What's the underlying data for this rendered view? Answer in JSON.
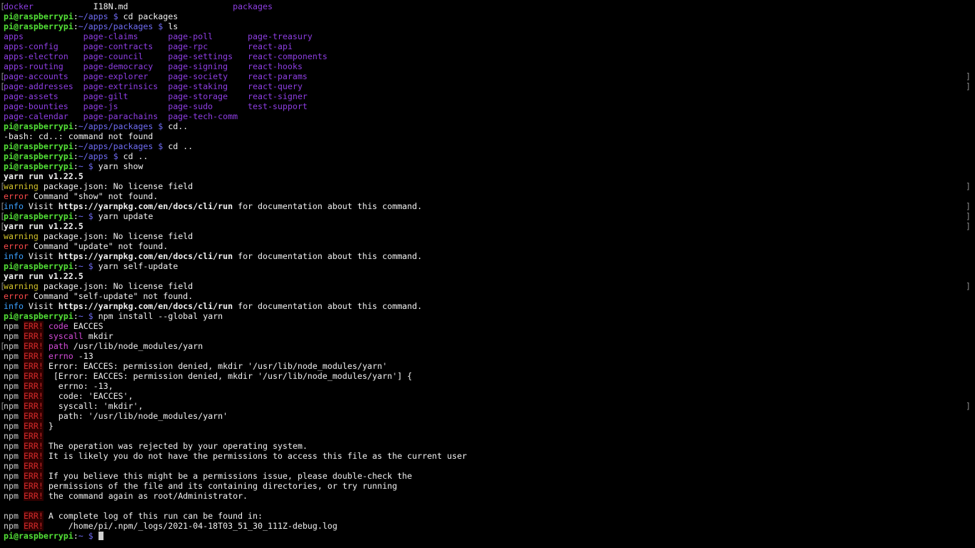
{
  "colors": {
    "background": "#000000",
    "prompt_user_host": "#53e236",
    "prompt_path": "#6f6cf5",
    "directory": "#8e3ee3",
    "warning": "#d3c22a",
    "error": "#ff4b4b",
    "info": "#3aa0ff",
    "npm_err_key": "#d34bd8",
    "npm_err_badge": "#d32a2a"
  },
  "terminal": {
    "lines": [
      {
        "lb": "[",
        "segs": [
          {
            "c": "c-purple",
            "t": "docker"
          },
          {
            "c": "c-white",
            "t": "            I18N.md                     "
          },
          {
            "c": "c-purple",
            "t": "packages"
          }
        ]
      },
      {
        "segs": [
          {
            "c": "c-green",
            "t": "pi@raspberrypi"
          },
          {
            "c": "c-white",
            "t": ":"
          },
          {
            "c": "c-blue",
            "t": "~/apps $"
          },
          {
            "c": "c-white",
            "t": " cd packages"
          }
        ]
      },
      {
        "segs": [
          {
            "c": "c-green",
            "t": "pi@raspberrypi"
          },
          {
            "c": "c-white",
            "t": ":"
          },
          {
            "c": "c-blue",
            "t": "~/apps/packages $"
          },
          {
            "c": "c-white",
            "t": " ls"
          }
        ]
      },
      {
        "segs": [
          {
            "c": "c-purple",
            "t": "apps            page-claims      page-poll       page-treasury"
          }
        ]
      },
      {
        "segs": [
          {
            "c": "c-purple",
            "t": "apps-config     page-contracts   page-rpc        react-api"
          }
        ]
      },
      {
        "segs": [
          {
            "c": "c-purple",
            "t": "apps-electron   page-council     page-settings   react-components"
          }
        ]
      },
      {
        "segs": [
          {
            "c": "c-purple",
            "t": "apps-routing    page-democracy   page-signing    react-hooks"
          }
        ]
      },
      {
        "lb": "[",
        "rb": "]",
        "segs": [
          {
            "c": "c-purple",
            "t": "page-accounts   page-explorer    page-society    react-params"
          }
        ]
      },
      {
        "lb": "[",
        "rb": "]",
        "segs": [
          {
            "c": "c-purple",
            "t": "page-addresses  page-extrinsics  page-staking    react-query"
          }
        ]
      },
      {
        "segs": [
          {
            "c": "c-purple",
            "t": "page-assets     page-gilt        page-storage    react-signer"
          }
        ]
      },
      {
        "segs": [
          {
            "c": "c-purple",
            "t": "page-bounties   page-js          page-sudo       test-support"
          }
        ]
      },
      {
        "segs": [
          {
            "c": "c-purple",
            "t": "page-calendar   page-parachains  page-tech-comm"
          }
        ]
      },
      {
        "segs": [
          {
            "c": "c-green",
            "t": "pi@raspberrypi"
          },
          {
            "c": "c-white",
            "t": ":"
          },
          {
            "c": "c-blue",
            "t": "~/apps/packages $"
          },
          {
            "c": "c-white",
            "t": " cd.."
          }
        ]
      },
      {
        "segs": [
          {
            "c": "c-white",
            "t": "-bash: cd..: command not found"
          }
        ]
      },
      {
        "segs": [
          {
            "c": "c-green",
            "t": "pi@raspberrypi"
          },
          {
            "c": "c-white",
            "t": ":"
          },
          {
            "c": "c-blue",
            "t": "~/apps/packages $"
          },
          {
            "c": "c-white",
            "t": " cd .."
          }
        ]
      },
      {
        "segs": [
          {
            "c": "c-green",
            "t": "pi@raspberrypi"
          },
          {
            "c": "c-white",
            "t": ":"
          },
          {
            "c": "c-blue",
            "t": "~/apps $"
          },
          {
            "c": "c-white",
            "t": " cd .."
          }
        ]
      },
      {
        "segs": [
          {
            "c": "c-green",
            "t": "pi@raspberrypi"
          },
          {
            "c": "c-white",
            "t": ":"
          },
          {
            "c": "c-blue",
            "t": "~ $"
          },
          {
            "c": "c-white",
            "t": " yarn show"
          }
        ]
      },
      {
        "segs": [
          {
            "c": "c-white bold",
            "t": "yarn run v1.22.5"
          }
        ]
      },
      {
        "lb": "[",
        "rb": "]",
        "segs": [
          {
            "c": "c-yellow",
            "t": "warning"
          },
          {
            "c": "c-white",
            "t": " package.json: No license field"
          }
        ]
      },
      {
        "segs": [
          {
            "c": "c-red",
            "t": "error"
          },
          {
            "c": "c-white",
            "t": " Command \"show\" not found."
          }
        ]
      },
      {
        "lb": "[",
        "rb": "]",
        "segs": [
          {
            "c": "c-cyan",
            "t": "info"
          },
          {
            "c": "c-white",
            "t": " Visit "
          },
          {
            "c": "c-white bold",
            "t": "https://yarnpkg.com/en/docs/cli/run"
          },
          {
            "c": "c-white",
            "t": " for documentation about this command."
          }
        ]
      },
      {
        "lb": "[",
        "rb": "]",
        "segs": [
          {
            "c": "c-green",
            "t": "pi@raspberrypi"
          },
          {
            "c": "c-white",
            "t": ":"
          },
          {
            "c": "c-blue",
            "t": "~ $"
          },
          {
            "c": "c-white",
            "t": " yarn update"
          }
        ]
      },
      {
        "lb": "[",
        "rb": "]",
        "segs": [
          {
            "c": "c-white bold",
            "t": "yarn run v1.22.5"
          }
        ]
      },
      {
        "segs": [
          {
            "c": "c-yellow",
            "t": "warning"
          },
          {
            "c": "c-white",
            "t": " package.json: No license field"
          }
        ]
      },
      {
        "segs": [
          {
            "c": "c-red",
            "t": "error"
          },
          {
            "c": "c-white",
            "t": " Command \"update\" not found."
          }
        ]
      },
      {
        "segs": [
          {
            "c": "c-cyan",
            "t": "info"
          },
          {
            "c": "c-white",
            "t": " Visit "
          },
          {
            "c": "c-white bold",
            "t": "https://yarnpkg.com/en/docs/cli/run"
          },
          {
            "c": "c-white",
            "t": " for documentation about this command."
          }
        ]
      },
      {
        "segs": [
          {
            "c": "c-green",
            "t": "pi@raspberrypi"
          },
          {
            "c": "c-white",
            "t": ":"
          },
          {
            "c": "c-blue",
            "t": "~ $"
          },
          {
            "c": "c-white",
            "t": " yarn self-update"
          }
        ]
      },
      {
        "segs": [
          {
            "c": "c-white bold",
            "t": "yarn run v1.22.5"
          }
        ]
      },
      {
        "lb": "[",
        "rb": "]",
        "segs": [
          {
            "c": "c-yellow",
            "t": "warning"
          },
          {
            "c": "c-white",
            "t": " package.json: No license field"
          }
        ]
      },
      {
        "segs": [
          {
            "c": "c-red",
            "t": "error"
          },
          {
            "c": "c-white",
            "t": " Command \"self-update\" not found."
          }
        ]
      },
      {
        "segs": [
          {
            "c": "c-cyan",
            "t": "info"
          },
          {
            "c": "c-white",
            "t": " Visit "
          },
          {
            "c": "c-white bold",
            "t": "https://yarnpkg.com/en/docs/cli/run"
          },
          {
            "c": "c-white",
            "t": " for documentation about this command."
          }
        ]
      },
      {
        "segs": [
          {
            "c": "c-green",
            "t": "pi@raspberrypi"
          },
          {
            "c": "c-white",
            "t": ":"
          },
          {
            "c": "c-blue",
            "t": "~ $"
          },
          {
            "c": "c-white",
            "t": " npm install --global yarn"
          }
        ]
      },
      {
        "segs": [
          {
            "c": "c-npmbox",
            "t": "npm"
          },
          {
            "c": "c-white",
            "t": " "
          },
          {
            "c": "c-errbox",
            "t": "ERR!"
          },
          {
            "c": "c-white",
            "t": " "
          },
          {
            "c": "c-magenta",
            "t": "code"
          },
          {
            "c": "c-white",
            "t": " EACCES"
          }
        ]
      },
      {
        "segs": [
          {
            "c": "c-npmbox",
            "t": "npm"
          },
          {
            "c": "c-white",
            "t": " "
          },
          {
            "c": "c-errbox",
            "t": "ERR!"
          },
          {
            "c": "c-white",
            "t": " "
          },
          {
            "c": "c-magenta",
            "t": "syscall"
          },
          {
            "c": "c-white",
            "t": " mkdir"
          }
        ]
      },
      {
        "lb": "[",
        "segs": [
          {
            "c": "c-npmbox",
            "t": "npm"
          },
          {
            "c": "c-white",
            "t": " "
          },
          {
            "c": "c-errbox",
            "t": "ERR!"
          },
          {
            "c": "c-white",
            "t": " "
          },
          {
            "c": "c-magenta",
            "t": "path"
          },
          {
            "c": "c-white",
            "t": " /usr/lib/node_modules/yarn"
          }
        ]
      },
      {
        "segs": [
          {
            "c": "c-npmbox",
            "t": "npm"
          },
          {
            "c": "c-white",
            "t": " "
          },
          {
            "c": "c-errbox",
            "t": "ERR!"
          },
          {
            "c": "c-white",
            "t": " "
          },
          {
            "c": "c-magenta",
            "t": "errno"
          },
          {
            "c": "c-white",
            "t": " -13"
          }
        ]
      },
      {
        "segs": [
          {
            "c": "c-npmbox",
            "t": "npm"
          },
          {
            "c": "c-white",
            "t": " "
          },
          {
            "c": "c-errbox",
            "t": "ERR!"
          },
          {
            "c": "c-white",
            "t": " Error: EACCES: permission denied, mkdir '/usr/lib/node_modules/yarn'"
          }
        ]
      },
      {
        "segs": [
          {
            "c": "c-npmbox",
            "t": "npm"
          },
          {
            "c": "c-white",
            "t": " "
          },
          {
            "c": "c-errbox",
            "t": "ERR!"
          },
          {
            "c": "c-white",
            "t": "  [Error: EACCES: permission denied, mkdir '/usr/lib/node_modules/yarn'] {"
          }
        ]
      },
      {
        "segs": [
          {
            "c": "c-npmbox",
            "t": "npm"
          },
          {
            "c": "c-white",
            "t": " "
          },
          {
            "c": "c-errbox",
            "t": "ERR!"
          },
          {
            "c": "c-white",
            "t": "   errno: -13,"
          }
        ]
      },
      {
        "segs": [
          {
            "c": "c-npmbox",
            "t": "npm"
          },
          {
            "c": "c-white",
            "t": " "
          },
          {
            "c": "c-errbox",
            "t": "ERR!"
          },
          {
            "c": "c-white",
            "t": "   code: 'EACCES',"
          }
        ]
      },
      {
        "lb": "[",
        "rb": "]",
        "segs": [
          {
            "c": "c-npmbox",
            "t": "npm"
          },
          {
            "c": "c-white",
            "t": " "
          },
          {
            "c": "c-errbox",
            "t": "ERR!"
          },
          {
            "c": "c-white",
            "t": "   syscall: 'mkdir',"
          }
        ]
      },
      {
        "segs": [
          {
            "c": "c-npmbox",
            "t": "npm"
          },
          {
            "c": "c-white",
            "t": " "
          },
          {
            "c": "c-errbox",
            "t": "ERR!"
          },
          {
            "c": "c-white",
            "t": "   path: '/usr/lib/node_modules/yarn'"
          }
        ]
      },
      {
        "segs": [
          {
            "c": "c-npmbox",
            "t": "npm"
          },
          {
            "c": "c-white",
            "t": " "
          },
          {
            "c": "c-errbox",
            "t": "ERR!"
          },
          {
            "c": "c-white",
            "t": " }"
          }
        ]
      },
      {
        "segs": [
          {
            "c": "c-npmbox",
            "t": "npm"
          },
          {
            "c": "c-white",
            "t": " "
          },
          {
            "c": "c-errbox",
            "t": "ERR!"
          }
        ]
      },
      {
        "segs": [
          {
            "c": "c-npmbox",
            "t": "npm"
          },
          {
            "c": "c-white",
            "t": " "
          },
          {
            "c": "c-errbox",
            "t": "ERR!"
          },
          {
            "c": "c-white",
            "t": " The operation was rejected by your operating system."
          }
        ]
      },
      {
        "segs": [
          {
            "c": "c-npmbox",
            "t": "npm"
          },
          {
            "c": "c-white",
            "t": " "
          },
          {
            "c": "c-errbox",
            "t": "ERR!"
          },
          {
            "c": "c-white",
            "t": " It is likely you do not have the permissions to access this file as the current user"
          }
        ]
      },
      {
        "segs": [
          {
            "c": "c-npmbox",
            "t": "npm"
          },
          {
            "c": "c-white",
            "t": " "
          },
          {
            "c": "c-errbox",
            "t": "ERR!"
          }
        ]
      },
      {
        "segs": [
          {
            "c": "c-npmbox",
            "t": "npm"
          },
          {
            "c": "c-white",
            "t": " "
          },
          {
            "c": "c-errbox",
            "t": "ERR!"
          },
          {
            "c": "c-white",
            "t": " If you believe this might be a permissions issue, please double-check the"
          }
        ]
      },
      {
        "segs": [
          {
            "c": "c-npmbox",
            "t": "npm"
          },
          {
            "c": "c-white",
            "t": " "
          },
          {
            "c": "c-errbox",
            "t": "ERR!"
          },
          {
            "c": "c-white",
            "t": " permissions of the file and its containing directories, or try running"
          }
        ]
      },
      {
        "segs": [
          {
            "c": "c-npmbox",
            "t": "npm"
          },
          {
            "c": "c-white",
            "t": " "
          },
          {
            "c": "c-errbox",
            "t": "ERR!"
          },
          {
            "c": "c-white",
            "t": " the command again as root/Administrator."
          }
        ]
      },
      {
        "segs": [
          {
            "c": "c-white",
            "t": ""
          }
        ]
      },
      {
        "segs": [
          {
            "c": "c-npmbox",
            "t": "npm"
          },
          {
            "c": "c-white",
            "t": " "
          },
          {
            "c": "c-errbox",
            "t": "ERR!"
          },
          {
            "c": "c-white",
            "t": " A complete log of this run can be found in:"
          }
        ]
      },
      {
        "segs": [
          {
            "c": "c-npmbox",
            "t": "npm"
          },
          {
            "c": "c-white",
            "t": " "
          },
          {
            "c": "c-errbox",
            "t": "ERR!"
          },
          {
            "c": "c-white",
            "t": "     /home/pi/.npm/_logs/2021-04-18T03_51_30_111Z-debug.log"
          }
        ]
      },
      {
        "cursor": true,
        "segs": [
          {
            "c": "c-green",
            "t": "pi@raspberrypi"
          },
          {
            "c": "c-white",
            "t": ":"
          },
          {
            "c": "c-blue",
            "t": "~ $"
          },
          {
            "c": "c-white",
            "t": " "
          }
        ]
      }
    ]
  }
}
